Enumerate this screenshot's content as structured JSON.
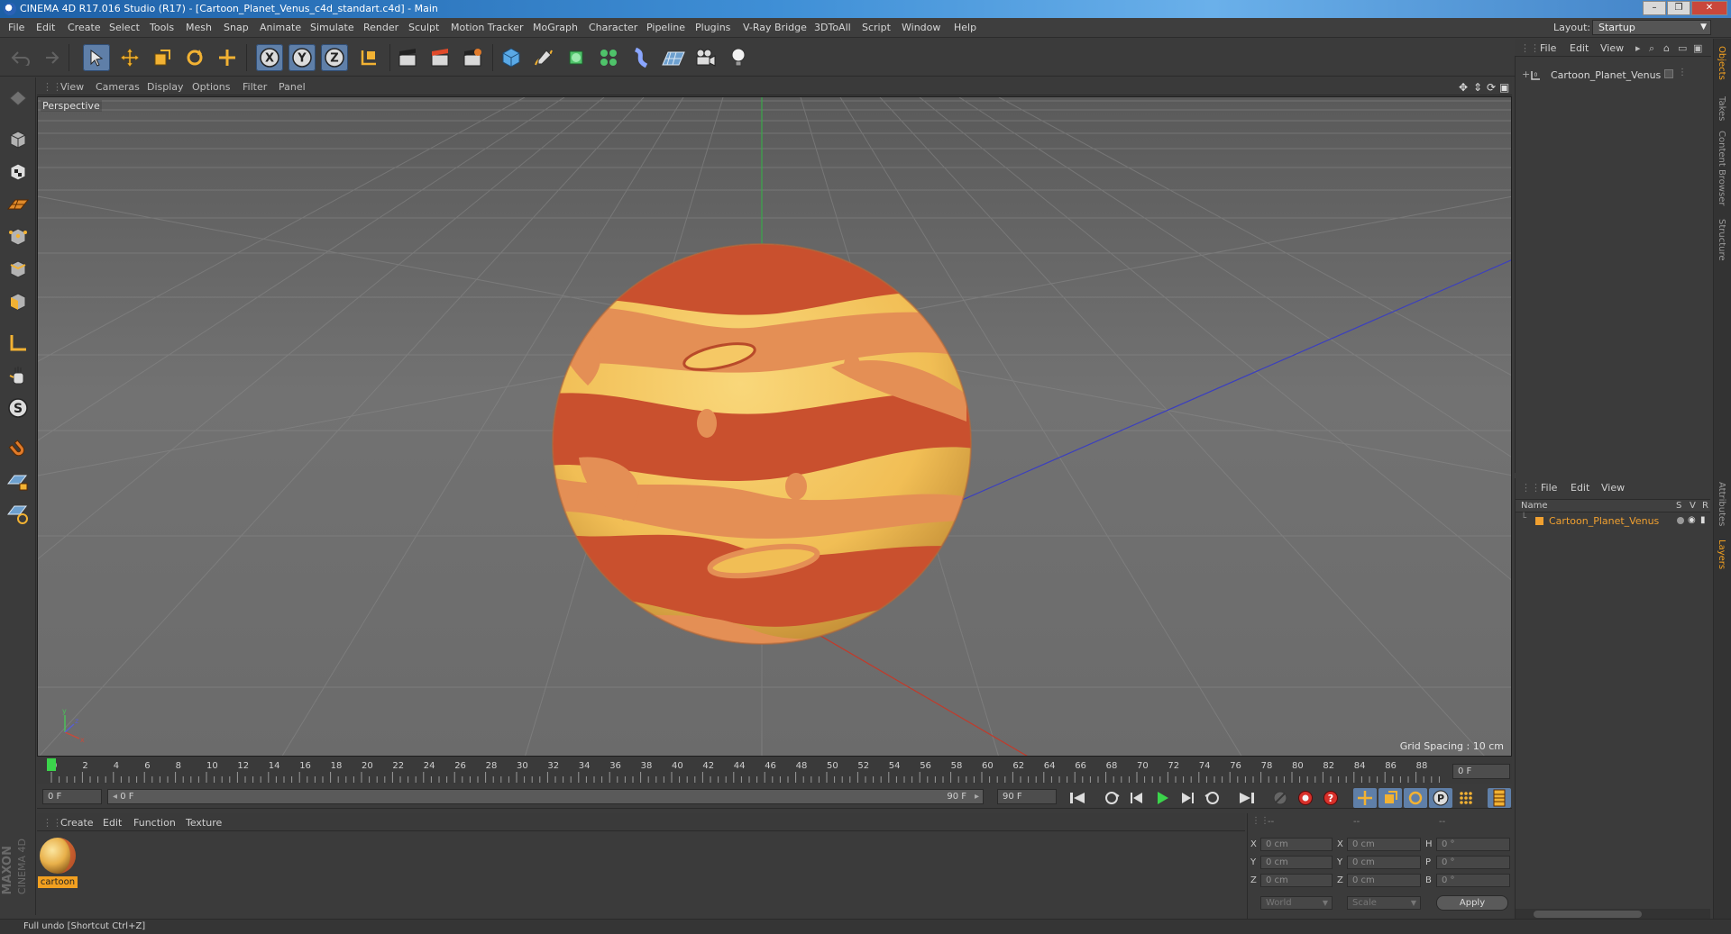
{
  "window": {
    "title": "CINEMA 4D R17.016 Studio (R17) - [Cartoon_Planet_Venus_c4d_standart.c4d] - Main",
    "buttons": [
      "–",
      "❐",
      "✕"
    ]
  },
  "menubar": {
    "items": [
      "File",
      "Edit",
      "Create",
      "Select",
      "Tools",
      "Mesh",
      "Snap",
      "Animate",
      "Simulate",
      "Render",
      "Sculpt",
      "Motion Tracker",
      "MoGraph",
      "Character",
      "Pipeline",
      "Plugins",
      "V-Ray Bridge",
      "3DToAll",
      "Script",
      "Window",
      "Help"
    ],
    "layout_label": "Layout:",
    "layout_value": "Startup"
  },
  "toolbar": {
    "axis_x": "X",
    "axis_y": "Y",
    "axis_z": "Z"
  },
  "viewport": {
    "menu": [
      "View",
      "Cameras",
      "Display",
      "Options",
      "Filter",
      "Panel"
    ],
    "camera_label": "Perspective",
    "grid_spacing": "Grid Spacing : 10 cm"
  },
  "timeline": {
    "ticks": [
      "0",
      "2",
      "4",
      "6",
      "8",
      "10",
      "12",
      "14",
      "16",
      "18",
      "20",
      "22",
      "24",
      "26",
      "28",
      "30",
      "32",
      "34",
      "36",
      "38",
      "40",
      "42",
      "44",
      "46",
      "48",
      "50",
      "52",
      "54",
      "56",
      "58",
      "60",
      "62",
      "64",
      "66",
      "68",
      "70",
      "72",
      "74",
      "76",
      "78",
      "80",
      "82",
      "84",
      "86",
      "88",
      "90"
    ],
    "current_frame": "0 F",
    "start_frame": "0 F",
    "range_start": "0 F",
    "range_end": "90 F",
    "end_frame": "90 F"
  },
  "material_manager": {
    "menu": [
      "Create",
      "Edit",
      "Function",
      "Texture"
    ],
    "materials": [
      {
        "name": "cartoon"
      }
    ]
  },
  "coordinates": {
    "headers": [
      "--",
      "--",
      "--"
    ],
    "rows": [
      {
        "label": "X",
        "pos": "0 cm",
        "size_label": "X",
        "size": "0 cm",
        "rot_label": "H",
        "rot": "0 °"
      },
      {
        "label": "Y",
        "pos": "0 cm",
        "size_label": "Y",
        "size": "0 cm",
        "rot_label": "P",
        "rot": "0 °"
      },
      {
        "label": "Z",
        "pos": "0 cm",
        "size_label": "Z",
        "size": "0 cm",
        "rot_label": "B",
        "rot": "0 °"
      }
    ],
    "mode_world": "World",
    "mode_scale": "Scale",
    "apply": "Apply"
  },
  "object_manager": {
    "menu": [
      "File",
      "Edit",
      "View"
    ],
    "objects": [
      {
        "name": "Cartoon_Planet_Venus"
      }
    ]
  },
  "layer_manager": {
    "menu": [
      "File",
      "Edit",
      "View"
    ],
    "col_name": "Name",
    "col_s": "S",
    "col_v": "V",
    "col_r": "R",
    "layers": [
      {
        "name": "Cartoon_Planet_Venus",
        "color": "#f0a030"
      }
    ]
  },
  "side_tabs": [
    "Objects",
    "Takes",
    "Content Browser",
    "Structure",
    "Attributes",
    "Layers"
  ],
  "brand": {
    "line1": "MAXON",
    "line2": "CINEMA 4D"
  },
  "status": {
    "text": "Full undo [Shortcut Ctrl+Z]"
  },
  "colors": {
    "planet_base": "#f3c25e",
    "planet_band_dark": "#c9502e",
    "planet_band_light": "#e48f55",
    "accent_blue": "#5f7fa8"
  }
}
